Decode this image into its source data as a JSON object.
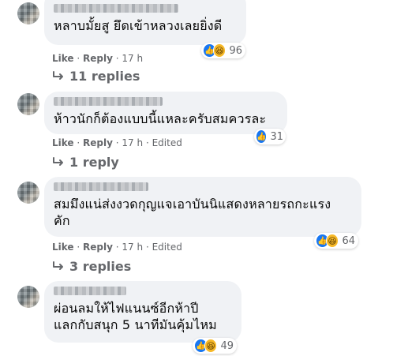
{
  "comments": [
    {
      "text": "หลาบมั้ยสู ยึดเข้าหลวงเลยยิ่งดี",
      "reaction_count": "96",
      "like": "Like",
      "reply": "Reply",
      "time": "17 h",
      "edited": "",
      "replies": "11 replies"
    },
    {
      "text": "ห้าวนักก็ต้องแบบนี้แหละครับสมควรละ",
      "reaction_count": "31",
      "like": "Like",
      "reply": "Reply",
      "time": "17 h",
      "edited": "Edited",
      "replies": "1 reply"
    },
    {
      "text": "สมมึงแน่ส่งงวดกุญแจเอาบันนิแสดงหลายรถกะแรง\nคัก",
      "reaction_count": "64",
      "like": "Like",
      "reply": "Reply",
      "time": "17 h",
      "edited": "Edited",
      "replies": "3 replies"
    },
    {
      "text": "ผ่อนลมให้ไฟแนนซ์อีกห้าปี\nแลกกับสนุก 5 นาทีมันคุ้มไหม",
      "reaction_count": "49",
      "like": "",
      "reply": "",
      "time": "",
      "edited": "",
      "replies": ""
    }
  ],
  "separator": "·",
  "icons": {
    "like": "thumbs-up-icon",
    "haha": "laughing-face-icon",
    "reply_arrow": "reply-arrow-icon"
  },
  "colors": {
    "bubble": "#f0f2f5",
    "meta_text": "#65676b",
    "like_blue": "#1877f2",
    "haha_yellow": "#f7b928"
  }
}
